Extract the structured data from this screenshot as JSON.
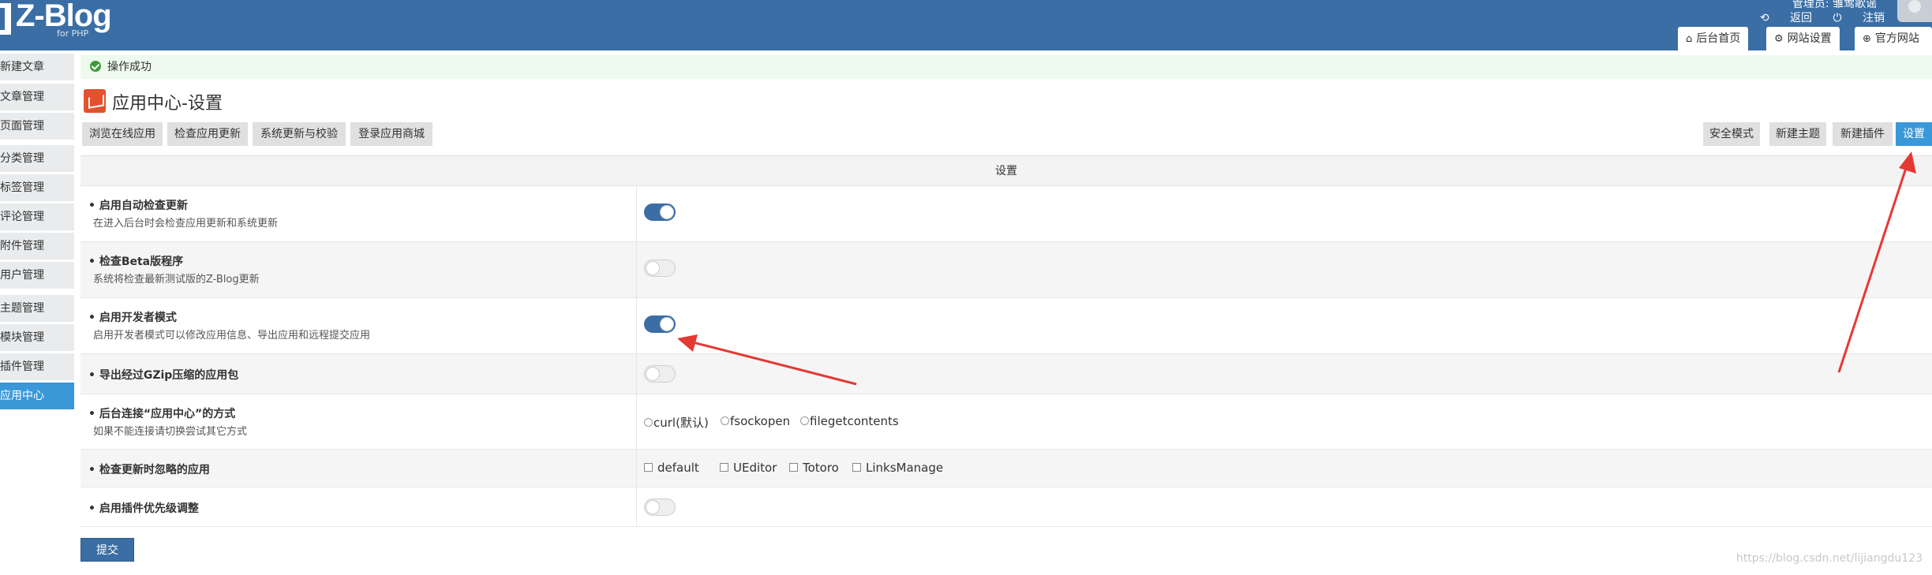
{
  "header": {
    "logo_text": "Z-Blog",
    "logo_sub": "for PHP",
    "manager_text": "管理员: 雏莺歌谣",
    "return_label": "返回",
    "logout_label": "注销",
    "tabs": [
      {
        "label": "后台首页",
        "icon": "home-icon"
      },
      {
        "label": "网站设置",
        "icon": "gear-icon"
      },
      {
        "label": "官方网站",
        "icon": "globe-icon"
      }
    ]
  },
  "sidebar": {
    "items": [
      {
        "label": "新建文章"
      },
      {
        "label": "文章管理"
      },
      {
        "label": "页面管理"
      },
      {
        "label": "分类管理"
      },
      {
        "label": "标签管理"
      },
      {
        "label": "评论管理"
      },
      {
        "label": "附件管理"
      },
      {
        "label": "用户管理"
      },
      {
        "label": "主题管理"
      },
      {
        "label": "模块管理"
      },
      {
        "label": "插件管理"
      },
      {
        "label": "应用中心",
        "active": true
      }
    ]
  },
  "status": {
    "message": "操作成功"
  },
  "page": {
    "title": "应用中心-设置"
  },
  "toolbar": {
    "left": [
      "浏览在线应用",
      "检查应用更新",
      "系统更新与校验",
      "登录应用商城"
    ],
    "right": [
      "安全模式",
      "新建主题",
      "新建插件",
      "设置"
    ],
    "active": "设置"
  },
  "table": {
    "header": "设置",
    "rows": [
      {
        "name": "启用自动检查更新",
        "desc": "在进入后台时会检查应用更新和系统更新",
        "control": "toggle",
        "value": true
      },
      {
        "name": "检查Beta版程序",
        "desc": "系统将检查最新测试版的Z-Blog更新",
        "control": "toggle",
        "value": false
      },
      {
        "name": "启用开发者模式",
        "desc": "启用开发者模式可以修改应用信息、导出应用和远程提交应用",
        "control": "toggle",
        "value": true
      },
      {
        "name": "导出经过GZip压缩的应用包",
        "desc": "",
        "control": "toggle",
        "value": false
      },
      {
        "name": "后台连接“应用中心”的方式",
        "desc": "如果不能连接请切换尝试其它方式",
        "control": "radio",
        "options": [
          "curl(默认)",
          "fsockopen",
          "filegetcontents"
        ]
      },
      {
        "name": "检查更新时忽略的应用",
        "desc": "",
        "control": "checkbox",
        "options": [
          "default",
          "UEditor",
          "Totoro",
          "LinksManage"
        ]
      },
      {
        "name": "启用插件优先级调整",
        "desc": "",
        "control": "toggle",
        "value": false
      }
    ]
  },
  "submit_label": "提交",
  "watermark": "https://blog.csdn.net/lijiangdu123",
  "colors": {
    "header": "#3a6ea5",
    "active_side": "#3a98d8",
    "success_bg": "#eefaee",
    "annotation": "#e53935"
  }
}
